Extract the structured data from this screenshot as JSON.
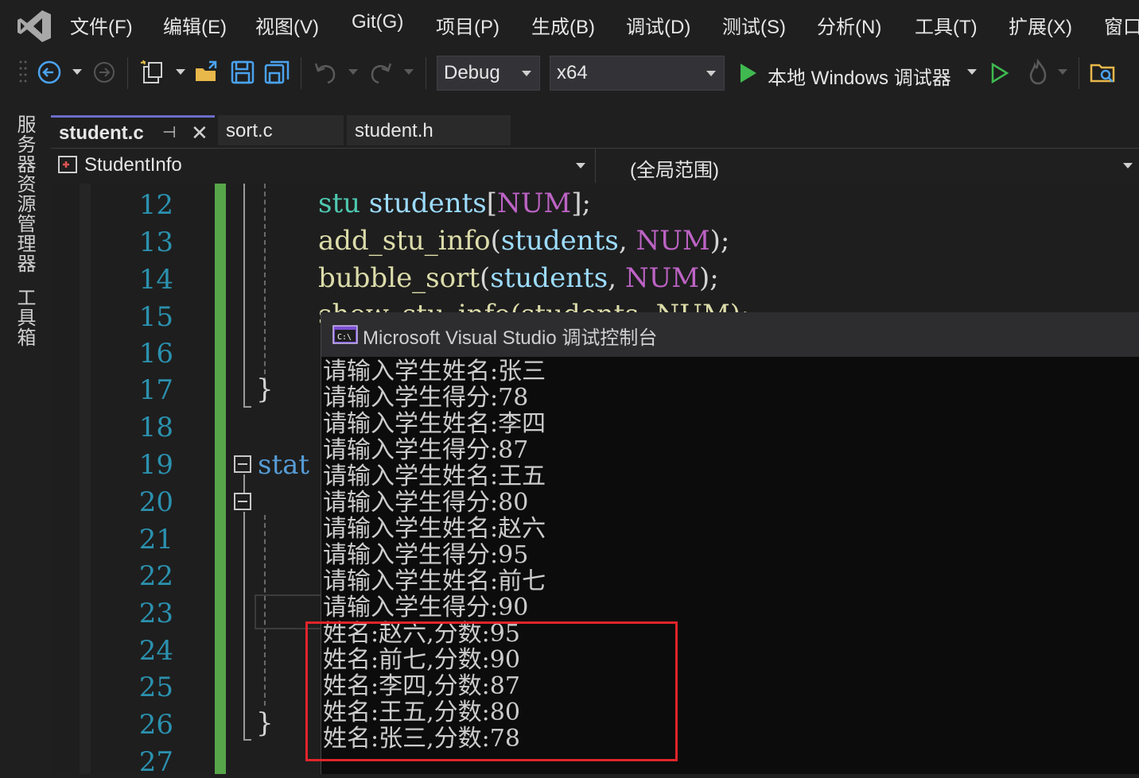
{
  "menu": {
    "items": [
      "文件(F)",
      "编辑(E)",
      "视图(V)",
      "Git(G)",
      "项目(P)",
      "生成(B)",
      "调试(D)",
      "测试(S)",
      "分析(N)",
      "工具(T)",
      "扩展(X)",
      "窗口"
    ]
  },
  "toolbar": {
    "configuration": "Debug",
    "platform": "x64",
    "run_label": "本地 Windows 调试器"
  },
  "left_dock": {
    "tabs": [
      "服务器资源管理器",
      "工具箱"
    ]
  },
  "tabs": [
    {
      "label": "student.c",
      "active": true
    },
    {
      "label": "sort.c",
      "active": false
    },
    {
      "label": "student.h",
      "active": false
    }
  ],
  "nav": {
    "scope_left": "StudentInfo",
    "scope_right": "(全局范围)"
  },
  "editor": {
    "line_numbers": [
      "12",
      "13",
      "14",
      "15",
      "16",
      "17",
      "18",
      "19",
      "20",
      "21",
      "22",
      "23",
      "24",
      "25",
      "26",
      "27"
    ],
    "code": {
      "l12_type": "stu",
      "l12_var": "students",
      "l12_open": "[",
      "l12_mac": "NUM",
      "l12_close": "];",
      "l13_fn": "add_stu_info",
      "l13_open": "(",
      "l13_var": "students",
      "l13_comma": ",",
      "l13_mac": "NUM",
      "l13_close": ");",
      "l14_fn": "bubble_sort",
      "l14_open": "(",
      "l14_var": "students",
      "l14_comma": ",",
      "l14_mac": "NUM",
      "l14_close": ");",
      "l15_partial": "show_stu_info(students, NUM);",
      "l17_brace": "}",
      "l19_kw": "stat",
      "l26_brace": "}"
    }
  },
  "console": {
    "title": "Microsoft Visual Studio 调试控制台",
    "lines": [
      "请输入学生姓名:张三",
      "请输入学生得分:78",
      "请输入学生姓名:李四",
      "请输入学生得分:87",
      "请输入学生姓名:王五",
      "请输入学生得分:80",
      "请输入学生姓名:赵六",
      "请输入学生得分:95",
      "请输入学生姓名:前七",
      "请输入学生得分:90",
      "姓名:赵六,分数:95",
      "姓名:前七,分数:90",
      "姓名:李四,分数:87",
      "姓名:王五,分数:80",
      "姓名:张三,分数:78"
    ]
  },
  "colors": {
    "accent_highlight": "#e0242b",
    "change_bar": "#57a64a",
    "line_number": "#2b91af"
  }
}
